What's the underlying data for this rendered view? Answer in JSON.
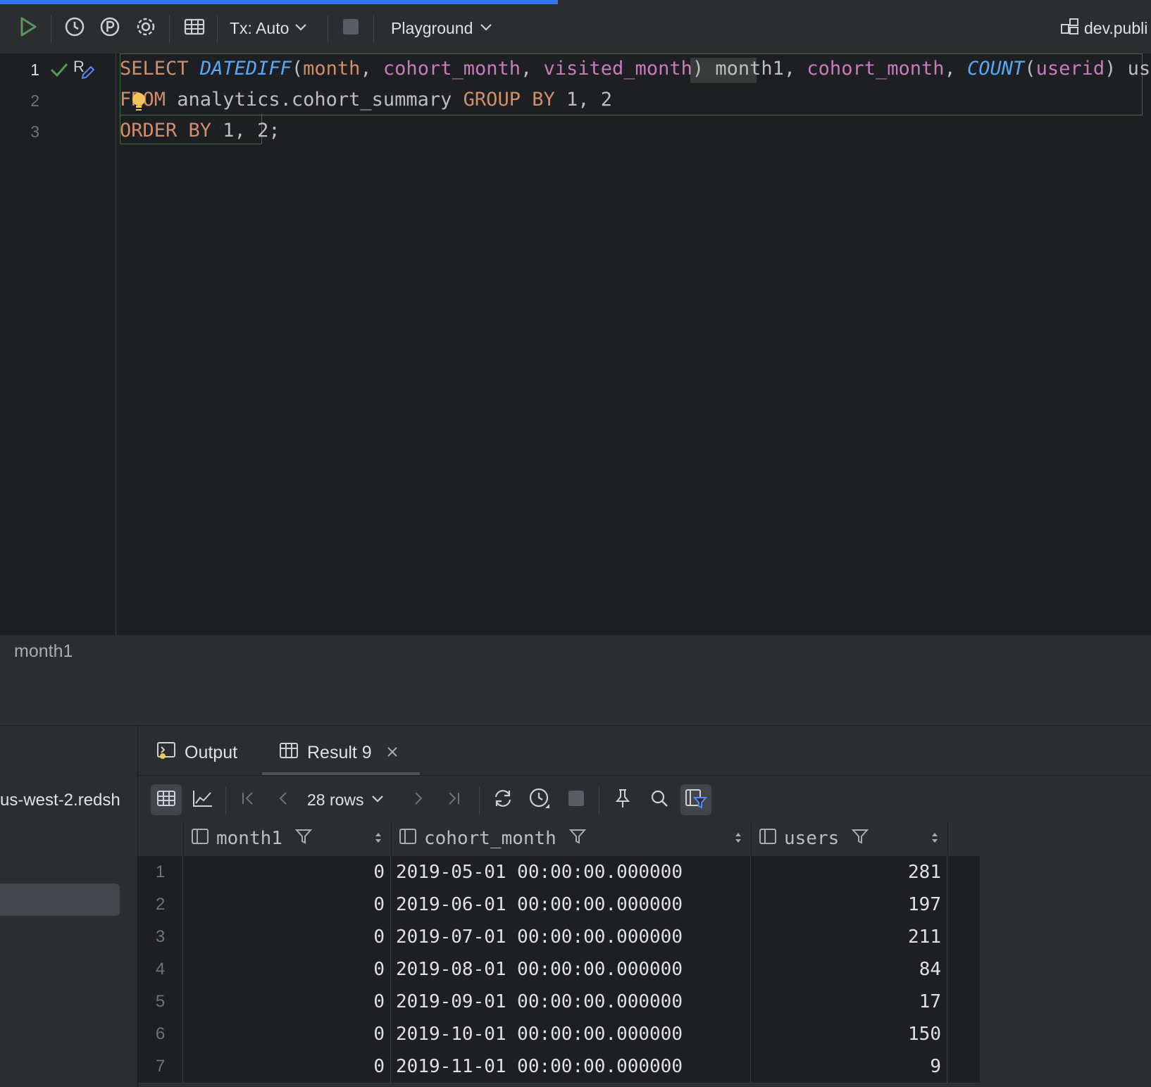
{
  "toolbar": {
    "tx_label": "Tx: Auto",
    "session_label": "Playground",
    "datasource_label": "dev.publi"
  },
  "editor": {
    "line_numbers": [
      "1",
      "2",
      "3"
    ],
    "line1": {
      "t1": "SELECT",
      "t2": " ",
      "t3": "DATEDIFF",
      "t4": "(",
      "t5": "month",
      "t6": ", ",
      "t7": "cohort_month",
      "t8": ", ",
      "t9": "visited_month",
      "t10": ") ",
      "t11": "month1",
      "t12": ", ",
      "t13": "cohort_month",
      "t14": ", ",
      "t15": "COUNT",
      "t16": "(",
      "t17": "userid",
      "t18": ") users"
    },
    "line2": {
      "t1": "FROM",
      "t2": " analytics.cohort_summary ",
      "t3": "GROUP BY",
      "t4": " 1, 2"
    },
    "line3": {
      "t1": "ORDER BY",
      "t2": " 1, 2;"
    },
    "inspection_badge": "R"
  },
  "breadcrumb": {
    "label": "month1"
  },
  "left_panel": {
    "host_text": "us-west-2.redsh"
  },
  "results": {
    "tabs": [
      {
        "label": "Output"
      },
      {
        "label": "Result 9"
      }
    ],
    "rows_label": "28 rows",
    "columns": [
      "month1",
      "cohort_month",
      "users"
    ],
    "rows": [
      {
        "n": "1",
        "month1": "0",
        "cohort_month": "2019-05-01 00:00:00.000000",
        "users": "281"
      },
      {
        "n": "2",
        "month1": "0",
        "cohort_month": "2019-06-01 00:00:00.000000",
        "users": "197"
      },
      {
        "n": "3",
        "month1": "0",
        "cohort_month": "2019-07-01 00:00:00.000000",
        "users": "211"
      },
      {
        "n": "4",
        "month1": "0",
        "cohort_month": "2019-08-01 00:00:00.000000",
        "users": "84"
      },
      {
        "n": "5",
        "month1": "0",
        "cohort_month": "2019-09-01 00:00:00.000000",
        "users": "17"
      },
      {
        "n": "6",
        "month1": "0",
        "cohort_month": "2019-10-01 00:00:00.000000",
        "users": "150"
      },
      {
        "n": "7",
        "month1": "0",
        "cohort_month": "2019-11-01 00:00:00.000000",
        "users": "9"
      }
    ]
  },
  "colors": {
    "accent": "#3574f0",
    "keyword": "#cf8e6d",
    "function": "#56a8f5",
    "column": "#c77dbb",
    "run": "#57965c"
  }
}
